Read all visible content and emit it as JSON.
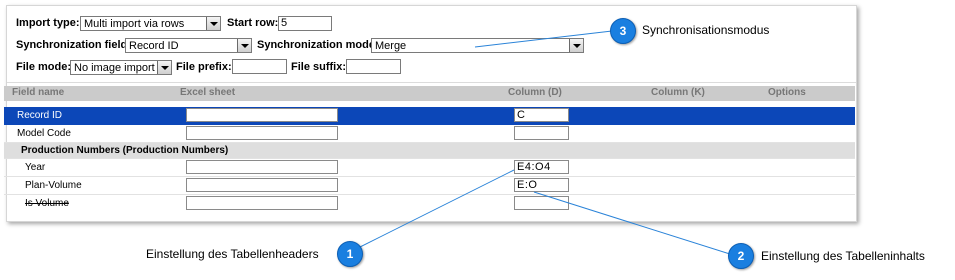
{
  "settings": {
    "import_type_label": "Import type:",
    "import_type_value": "Multi import via rows",
    "start_row_label": "Start row:",
    "start_row_value": "5",
    "sync_field_label": "Synchronization field:",
    "sync_field_value": "Record ID",
    "sync_mode_label": "Synchronization mode:",
    "sync_mode_value": "Merge",
    "file_mode_label": "File mode:",
    "file_mode_value": "No image import",
    "file_prefix_label": "File prefix:",
    "file_prefix_value": "",
    "file_suffix_label": "File suffix:",
    "file_suffix_value": ""
  },
  "table": {
    "headers": [
      "Field name",
      "Excel sheet",
      "Column (D)",
      "Column (K)",
      "Options"
    ],
    "rows": [
      {
        "name": "Record ID",
        "column_d": "C",
        "selected": true
      },
      {
        "name": "Model Code",
        "column_d": ""
      },
      {
        "name": "Production Numbers (Production Numbers)",
        "group": true
      },
      {
        "name": "Year",
        "column_d": "E4:O4"
      },
      {
        "name": "Plan-Volume",
        "column_d": "E:O"
      },
      {
        "name": "Is Volume",
        "column_d": "",
        "strikethrough": true
      }
    ]
  },
  "callouts": [
    {
      "number": "1",
      "text": "Einstellung des Tabellenheaders"
    },
    {
      "number": "2",
      "text": "Einstellung des Tabelleninhalts"
    },
    {
      "number": "3",
      "text": "Synchronisationsmodus"
    }
  ],
  "colors": {
    "selected_row": "#0c47b8",
    "header_bg": "#cbcbcb",
    "badge": "#1a7fe0",
    "callout_line": "#2a83d8"
  }
}
